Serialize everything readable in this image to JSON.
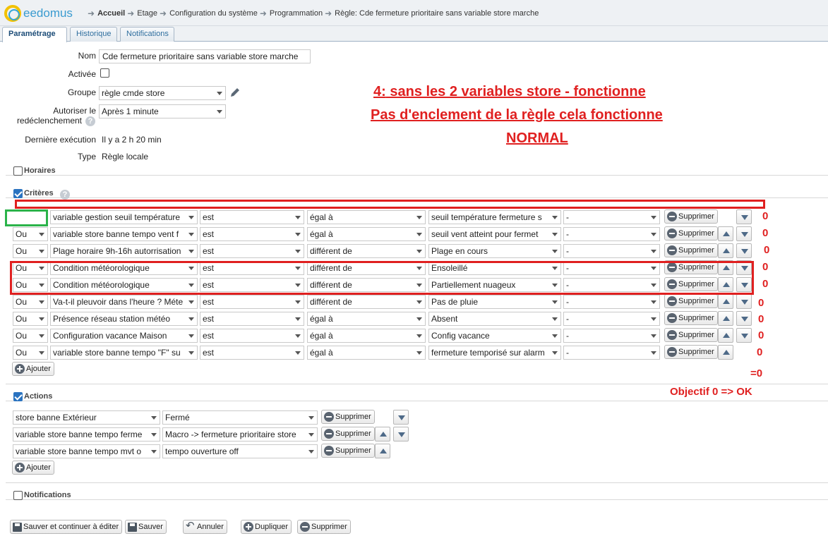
{
  "app": {
    "logo_text": "eedomus"
  },
  "breadcrumb": [
    "Accueil",
    "Etage",
    "Configuration du système",
    "Programmation",
    "Règle: Cde fermeture prioritaire sans variable store marche"
  ],
  "tabs": [
    "Paramétrage",
    "Historique",
    "Notifications"
  ],
  "form": {
    "nom_label": "Nom",
    "nom_value": "Cde fermeture prioritaire sans variable store marche",
    "activee_label": "Activée",
    "groupe_label": "Groupe",
    "groupe_value": "règle cmde store",
    "autoriser_label1": "Autoriser le",
    "autoriser_label2": "redéclenchement",
    "autoriser_value": "Après 1 minute",
    "derniere_label": "Dernière exécution",
    "derniere_value": "Il y a 2 h 20 min",
    "type_label": "Type",
    "type_value": "Règle locale"
  },
  "sections": {
    "horaires": "Horaires",
    "criteres": "Critères",
    "actions": "Actions",
    "notifications": "Notifications"
  },
  "criteria": [
    {
      "op": "",
      "device": "variable gestion seuil température",
      "cond": "est",
      "comp": "égal à",
      "value": "seuil température fermeture s",
      "extra": "-",
      "del": "Supprimer"
    },
    {
      "op": "Ou",
      "device": "variable store banne tempo vent f",
      "cond": "est",
      "comp": "égal à",
      "value": "seuil vent atteint pour fermet",
      "extra": "-",
      "del": "Supprimer"
    },
    {
      "op": "Ou",
      "device": "Plage horaire 9h-16h autorrisation",
      "cond": "est",
      "comp": "différent de",
      "value": "Plage en cours",
      "extra": "-",
      "del": "Supprimer"
    },
    {
      "op": "Ou",
      "device": "Condition météorologique",
      "cond": "est",
      "comp": "différent de",
      "value": "Ensoleillé",
      "extra": "-",
      "del": "Supprimer"
    },
    {
      "op": "Ou",
      "device": "Condition météorologique",
      "cond": "est",
      "comp": "différent de",
      "value": "Partiellement nuageux",
      "extra": "-",
      "del": "Supprimer"
    },
    {
      "op": "Ou",
      "device": "Va-t-il pleuvoir dans l'heure ? Méte",
      "cond": "est",
      "comp": "différent de",
      "value": "Pas de pluie",
      "extra": "-",
      "del": "Supprimer"
    },
    {
      "op": "Ou",
      "device": "Présence réseau station météo",
      "cond": "est",
      "comp": "égal à",
      "value": "Absent",
      "extra": "-",
      "del": "Supprimer"
    },
    {
      "op": "Ou",
      "device": "Configuration vacance Maison",
      "cond": "est",
      "comp": "égal à",
      "value": "Config vacance",
      "extra": "-",
      "del": "Supprimer"
    },
    {
      "op": "Ou",
      "device": "variable store banne tempo \"F\" su",
      "cond": "est",
      "comp": "égal à",
      "value": "fermeture temporisé sur alarm",
      "extra": "-",
      "del": "Supprimer"
    }
  ],
  "actions": [
    {
      "device": "store banne Extérieur",
      "value": "Fermé",
      "del": "Supprimer"
    },
    {
      "device": "variable store banne tempo ferme",
      "value": "Macro -> fermeture prioritaire store",
      "del": "Supprimer"
    },
    {
      "device": "variable store banne tempo mvt o",
      "value": "tempo ouverture off",
      "del": "Supprimer"
    }
  ],
  "add_label": "Ajouter",
  "bottom": {
    "save_continue": "Sauver et continuer à éditer",
    "save": "Sauver",
    "cancel": "Annuler",
    "duplicate": "Dupliquer",
    "delete": "Supprimer"
  },
  "annotations": {
    "line1_prefix": "4:",
    "line1_rest": " sans les 2 variables store - fonctionne",
    "line2": "Pas d'enclement de la règle cela fonctionne",
    "line3": "NORMAL",
    "zeros": [
      "0",
      "0",
      "0",
      "0",
      "0",
      "0",
      "0",
      "0",
      "0"
    ],
    "sum": "=0",
    "objective": "Objectif 0 => OK"
  },
  "colors": {
    "annotation": "#e02020",
    "highlight_green": "#2bb34a",
    "tab_text": "#2e6e9e"
  }
}
